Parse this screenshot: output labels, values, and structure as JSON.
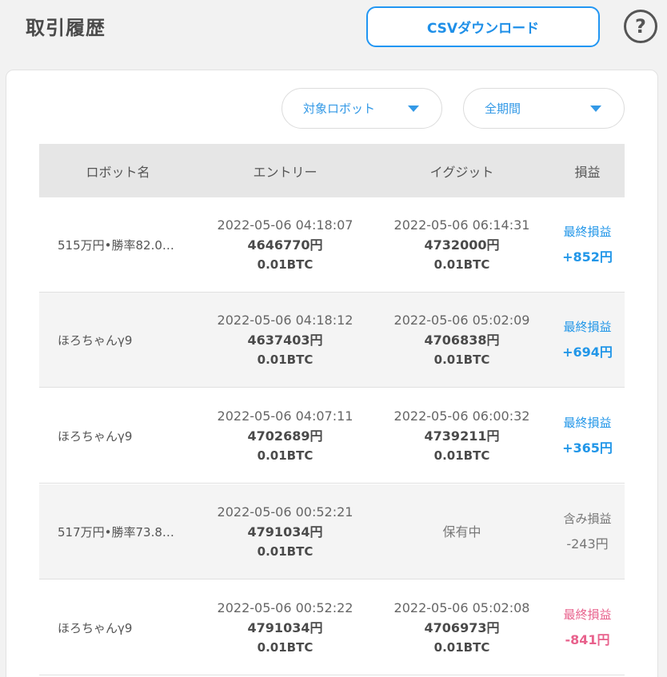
{
  "header": {
    "title": "取引履歴",
    "csv_button": "CSVダウンロード",
    "help_icon": "question-circle-icon"
  },
  "filters": {
    "robot": "対象ロボット",
    "period": "全期間"
  },
  "table": {
    "columns": [
      "ロボット名",
      "エントリー",
      "イグジット",
      "損益"
    ],
    "rows": [
      {
        "name": "515万円•勝率82.0…",
        "entry": {
          "datetime": "2022-05-06 04:18:07",
          "price": "4646770円",
          "amount": "0.01BTC"
        },
        "exit": {
          "datetime": "2022-05-06 06:14:31",
          "price": "4732000円",
          "amount": "0.01BTC"
        },
        "pl_label": "最終損益",
        "pl_value": "+852円",
        "status": "positive"
      },
      {
        "name": "ほろちゃんγ9",
        "entry": {
          "datetime": "2022-05-06 04:18:12",
          "price": "4637403円",
          "amount": "0.01BTC"
        },
        "exit": {
          "datetime": "2022-05-06 05:02:09",
          "price": "4706838円",
          "amount": "0.01BTC"
        },
        "pl_label": "最終損益",
        "pl_value": "+694円",
        "status": "positive"
      },
      {
        "name": "ほろちゃんγ9",
        "entry": {
          "datetime": "2022-05-06 04:07:11",
          "price": "4702689円",
          "amount": "0.01BTC"
        },
        "exit": {
          "datetime": "2022-05-06 06:00:32",
          "price": "4739211円",
          "amount": "0.01BTC"
        },
        "pl_label": "最終損益",
        "pl_value": "+365円",
        "status": "positive"
      },
      {
        "name": "517万円•勝率73.8…",
        "entry": {
          "datetime": "2022-05-06 00:52:21",
          "price": "4791034円",
          "amount": "0.01BTC"
        },
        "exit_status": "保有中",
        "pl_label": "含み損益",
        "pl_value": "-243円",
        "status": "unrealized"
      },
      {
        "name": "ほろちゃんγ9",
        "entry": {
          "datetime": "2022-05-06 00:52:22",
          "price": "4791034円",
          "amount": "0.01BTC"
        },
        "exit": {
          "datetime": "2022-05-06 05:02:08",
          "price": "4706973円",
          "amount": "0.01BTC"
        },
        "pl_label": "最終損益",
        "pl_value": "-841円",
        "status": "negative"
      }
    ]
  },
  "colors": {
    "accent": "#2196e8",
    "negative": "#e8618c",
    "header_bg": "#e6e6e6",
    "page_bg": "#f2f2f2"
  }
}
